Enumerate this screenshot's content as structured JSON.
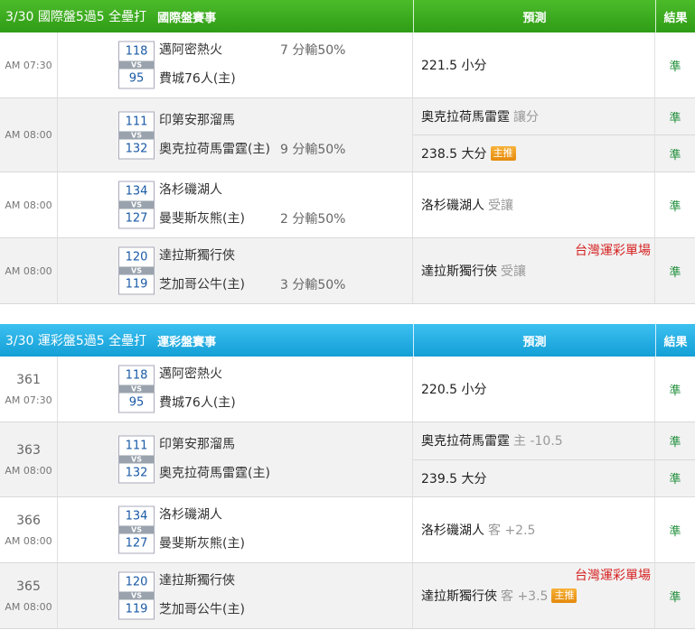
{
  "intl": {
    "title": "3/30 國際盤5過5 全壘打",
    "subtitle": "國際盤賽事",
    "pred_header": "預測",
    "res_header": "結果",
    "rows": [
      {
        "num": "",
        "time": "AM 07:30",
        "score_away": "118",
        "score_home": "95",
        "vs": "VS",
        "away": "邁阿密熱火",
        "home": "費城76人(主)",
        "handicap": "7 分輸50%",
        "handicap_on": "away",
        "preds": [
          {
            "text": "221.5 小分",
            "extra": "",
            "badge": "",
            "note": "",
            "result": "準"
          }
        ]
      },
      {
        "num": "",
        "time": "AM 08:00",
        "score_away": "111",
        "score_home": "132",
        "vs": "VS",
        "away": "印第安那溜馬",
        "home": "奧克拉荷馬雷霆(主)",
        "handicap": "9 分輸50%",
        "handicap_on": "home",
        "preds": [
          {
            "text": "奧克拉荷馬雷霆",
            "extra": "讓分",
            "badge": "",
            "note": "",
            "result": "準"
          },
          {
            "text": "238.5 大分",
            "extra": "",
            "badge": "主推",
            "note": "",
            "result": "準"
          }
        ]
      },
      {
        "num": "",
        "time": "AM 08:00",
        "score_away": "134",
        "score_home": "127",
        "vs": "VS",
        "away": "洛杉磯湖人",
        "home": "曼斐斯灰熊(主)",
        "handicap": "2 分輸50%",
        "handicap_on": "home",
        "preds": [
          {
            "text": "洛杉磯湖人",
            "extra": "受讓",
            "badge": "",
            "note": "",
            "result": "準"
          }
        ]
      },
      {
        "num": "",
        "time": "AM 08:00",
        "score_away": "120",
        "score_home": "119",
        "vs": "VS",
        "away": "達拉斯獨行俠",
        "home": "芝加哥公牛(主)",
        "handicap": "3 分輸50%",
        "handicap_on": "home",
        "preds": [
          {
            "text": "達拉斯獨行俠",
            "extra": "受讓",
            "badge": "",
            "note": "台灣運彩單場",
            "result": "準"
          }
        ]
      }
    ]
  },
  "tw": {
    "title": "3/30 運彩盤5過5 全壘打",
    "subtitle": "運彩盤賽事",
    "pred_header": "預測",
    "res_header": "結果",
    "rows": [
      {
        "num": "361",
        "time": "AM 07:30",
        "score_away": "118",
        "score_home": "95",
        "vs": "VS",
        "away": "邁阿密熱火",
        "home": "費城76人(主)",
        "handicap": "",
        "handicap_on": "",
        "preds": [
          {
            "text": "220.5 小分",
            "extra": "",
            "badge": "",
            "note": "",
            "result": "準"
          }
        ]
      },
      {
        "num": "363",
        "time": "AM 08:00",
        "score_away": "111",
        "score_home": "132",
        "vs": "VS",
        "away": "印第安那溜馬",
        "home": "奧克拉荷馬雷霆(主)",
        "handicap": "",
        "handicap_on": "",
        "preds": [
          {
            "text": "奧克拉荷馬雷霆",
            "extra": "主 -10.5",
            "badge": "",
            "note": "",
            "result": "準"
          },
          {
            "text": "239.5 大分",
            "extra": "",
            "badge": "",
            "note": "",
            "result": "準"
          }
        ]
      },
      {
        "num": "366",
        "time": "AM 08:00",
        "score_away": "134",
        "score_home": "127",
        "vs": "VS",
        "away": "洛杉磯湖人",
        "home": "曼斐斯灰熊(主)",
        "handicap": "",
        "handicap_on": "",
        "preds": [
          {
            "text": "洛杉磯湖人",
            "extra": "客 +2.5",
            "badge": "",
            "note": "",
            "result": "準"
          }
        ]
      },
      {
        "num": "365",
        "time": "AM 08:00",
        "score_away": "120",
        "score_home": "119",
        "vs": "VS",
        "away": "達拉斯獨行俠",
        "home": "芝加哥公牛(主)",
        "handicap": "",
        "handicap_on": "",
        "preds": [
          {
            "text": "達拉斯獨行俠",
            "extra": "客 +3.5",
            "badge": "主推",
            "note": "台灣運彩單場",
            "result": "準"
          }
        ]
      }
    ]
  }
}
